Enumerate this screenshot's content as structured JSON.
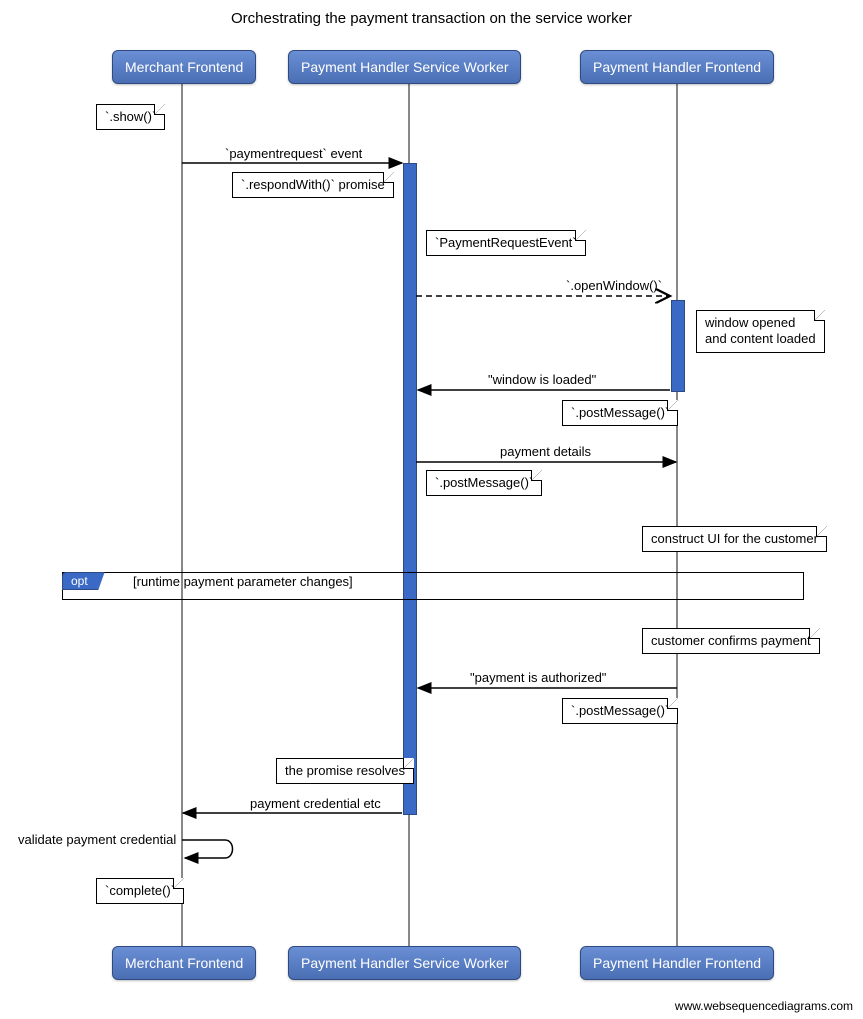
{
  "title": "Orchestrating the payment transaction on the service worker",
  "participants": {
    "merchant": "Merchant Frontend",
    "worker": "Payment Handler Service Worker",
    "frontend": "Payment Handler Frontend"
  },
  "notes": {
    "show": "`.show()`",
    "respondWith": "`.respondWith()` promise",
    "paymentRequestEvent": "`PaymentRequestEvent`",
    "windowOpened1": "window opened",
    "windowOpened2": "and content loaded",
    "postMessage1": "`.postMessage()`",
    "postMessage2": "`.postMessage()`",
    "constructUI": "construct UI for the customer",
    "customerConfirms": "customer confirms payment",
    "postMessage3": "`.postMessage()`",
    "promiseResolves": "the promise resolves",
    "complete": "`complete()`"
  },
  "messages": {
    "paymentrequest": "`paymentrequest` event",
    "openWindow": "`.openWindow()`",
    "windowLoaded": "\"window is loaded\"",
    "paymentDetails": "payment details",
    "paymentAuthorized": "\"payment is authorized\"",
    "paymentCredential": "payment credential etc",
    "validate": "validate payment credential"
  },
  "opt": {
    "tag": "opt",
    "guard": "[runtime payment parameter changes]"
  },
  "credit": "www.websequencediagrams.com"
}
